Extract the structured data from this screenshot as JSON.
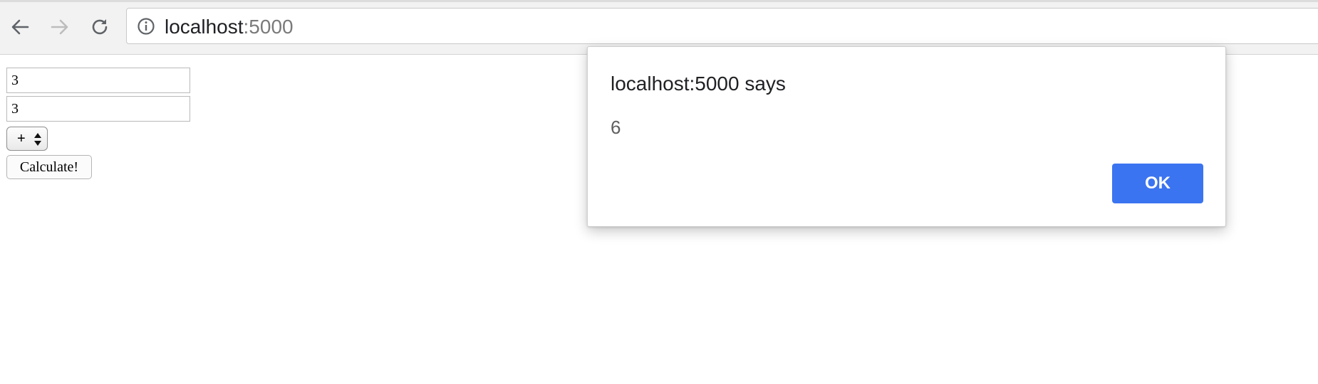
{
  "browser": {
    "url_host": "localhost",
    "url_port": ":5000",
    "icons": {
      "back": "back-arrow-icon",
      "forward": "forward-arrow-icon",
      "reload": "reload-icon",
      "site_info": "info-icon"
    }
  },
  "form": {
    "operand_a": "3",
    "operand_b": "3",
    "operator": "+",
    "submit_label": "Calculate!"
  },
  "alert": {
    "title": "localhost:5000 says",
    "message": "6",
    "ok_label": "OK",
    "accent_color": "#3b74f0"
  }
}
